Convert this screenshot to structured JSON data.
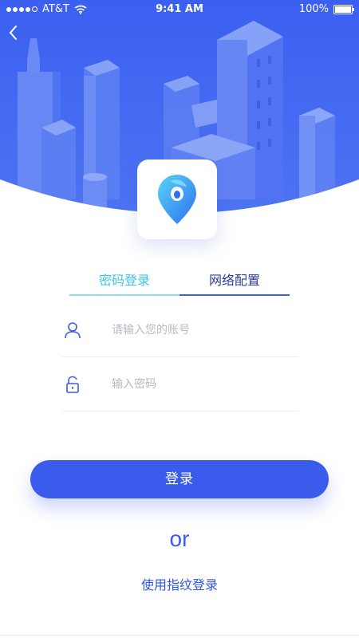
{
  "status_bar": {
    "carrier": "AT&T",
    "time": "9:41 AM",
    "battery": "100%",
    "battery_level": 1.0,
    "signal_bars": 4
  },
  "nav": {
    "back_icon": "chevron-left-icon"
  },
  "logo": {
    "icon": "map-pin-icon"
  },
  "tabs": [
    {
      "label": "密码登录",
      "color": "#3fc4e8"
    },
    {
      "label": "网络配置",
      "color": "#2f3a9a"
    }
  ],
  "form": {
    "account": {
      "icon": "user-icon",
      "placeholder": "请输入您的账号",
      "value": ""
    },
    "password": {
      "icon": "lock-icon",
      "placeholder": "输入密码",
      "value": ""
    }
  },
  "login_button": {
    "label": "登录"
  },
  "or_label": "or",
  "fingerprint_link": {
    "label": "使用指纹登录"
  },
  "colors": {
    "primary": "#3b5bed",
    "hero": "#3d63ee",
    "accent": "#3fc4e8"
  }
}
